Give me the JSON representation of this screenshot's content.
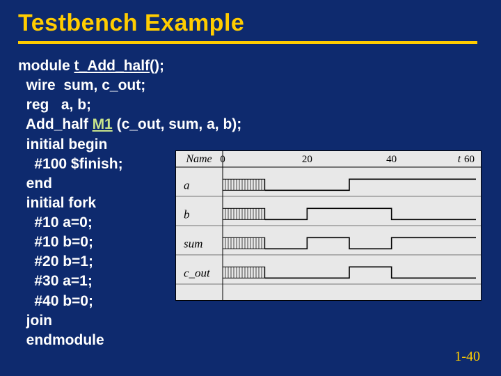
{
  "title": "Testbench Example",
  "code": {
    "l1a": "module ",
    "l1b": "t_Add_half",
    "l1c": "();",
    "l2": "  wire  sum, c_out;",
    "l3": "  reg   a, b;",
    "l4a": "  Add_half ",
    "l4b": "M1",
    "l4c": " (c_out, sum, a, b);",
    "l5": "  initial begin",
    "l6": "    #100 $finish;",
    "l7": "  end",
    "l8": "  initial fork",
    "l9": "    #10 a=0;",
    "l10": "    #10 b=0;",
    "l11": "    #20 b=1;",
    "l12": "    #30 a=1;",
    "l13": "    #40 b=0;",
    "l14": "  join",
    "l15": "  endmodule"
  },
  "page": "1-40",
  "chart_data": {
    "type": "line",
    "title": "",
    "xlabel": "",
    "ylabel": "",
    "xlim": [
      0,
      60
    ],
    "ticks": [
      0,
      20,
      40,
      60
    ],
    "name_col": "Name",
    "t_label": "t",
    "series": [
      {
        "name": "a",
        "segments": [
          {
            "t": 0,
            "v": null
          },
          {
            "t": 10,
            "v": 0
          },
          {
            "t": 30,
            "v": 1
          },
          {
            "t": 60,
            "v": 1
          }
        ]
      },
      {
        "name": "b",
        "segments": [
          {
            "t": 0,
            "v": null
          },
          {
            "t": 10,
            "v": 0
          },
          {
            "t": 20,
            "v": 1
          },
          {
            "t": 40,
            "v": 0
          },
          {
            "t": 60,
            "v": 0
          }
        ]
      },
      {
        "name": "sum",
        "segments": [
          {
            "t": 0,
            "v": null
          },
          {
            "t": 10,
            "v": 0
          },
          {
            "t": 20,
            "v": 1
          },
          {
            "t": 30,
            "v": 0
          },
          {
            "t": 40,
            "v": 1
          },
          {
            "t": 60,
            "v": 1
          }
        ]
      },
      {
        "name": "c_out",
        "segments": [
          {
            "t": 0,
            "v": null
          },
          {
            "t": 10,
            "v": 0
          },
          {
            "t": 30,
            "v": 1
          },
          {
            "t": 40,
            "v": 0
          },
          {
            "t": 60,
            "v": 0
          }
        ]
      }
    ]
  }
}
